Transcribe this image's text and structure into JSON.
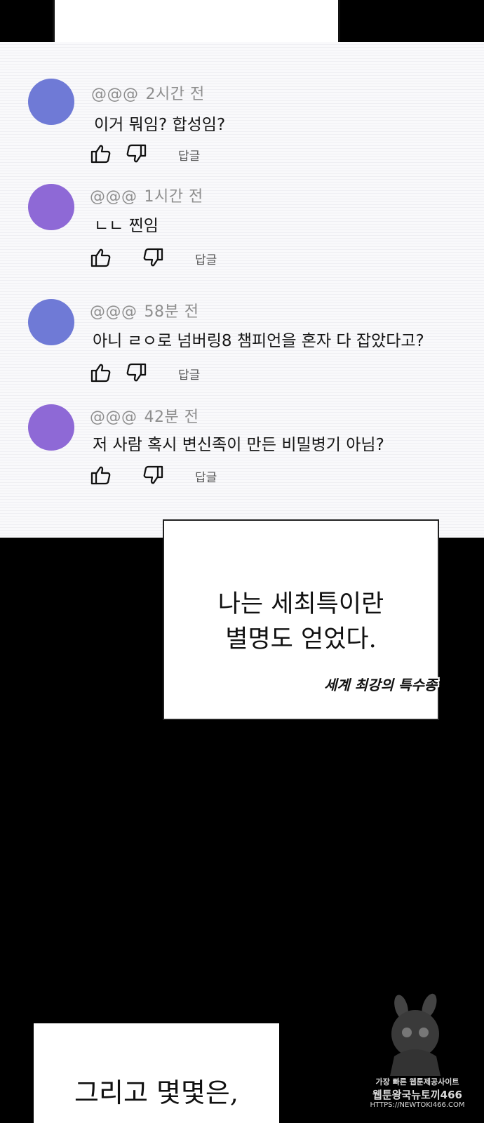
{
  "comments": [
    {
      "user": "@@@",
      "time": "2시간 전",
      "text": "이거 뭐임? 합성임?",
      "reply_label": "답글",
      "avatar_color": "#6f7ad6"
    },
    {
      "user": "@@@",
      "time": "1시간 전",
      "text": "ㄴㄴ 찐임",
      "reply_label": "답글",
      "avatar_color": "#8e69d6"
    },
    {
      "user": "@@@",
      "time": "58분 전",
      "text": "아니 ㄹㅇ로 넘버링8 챔피언을 혼자 다 잡았다고?",
      "reply_label": "답글",
      "avatar_color": "#6f7ad6"
    },
    {
      "user": "@@@",
      "time": "42분 전",
      "text": "저 사람 혹시 변신족이 만든 비밀병기 아님?",
      "reply_label": "답글",
      "avatar_color": "#8e69d6"
    }
  ],
  "narration": {
    "line1": "나는 세최특이란",
    "line2": "별명도 얻었다.",
    "stamp": "세계 최강의 특수종"
  },
  "bottom_caption": "그리고 몇몇은,",
  "watermark": {
    "line1": "가장 빠른 웹툰제공사이트",
    "line2": "웹툰왕국뉴토끼466",
    "line3": "HTTPS://NEWTOKI466.COM"
  }
}
